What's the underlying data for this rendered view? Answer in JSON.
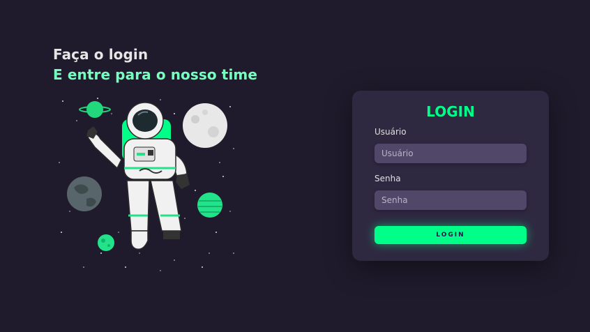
{
  "hero": {
    "title": "Faça o login",
    "subtitle": "E entre para o nosso time"
  },
  "illustration": {
    "name": "astronaut-illustration"
  },
  "login": {
    "title": "LOGIN",
    "username_label": "Usuário",
    "username_placeholder": "Usuário",
    "password_label": "Senha",
    "password_placeholder": "Senha",
    "button_label": "LOGIN"
  },
  "colors": {
    "background": "#201b2c",
    "card": "#2f2841",
    "input": "#514869",
    "accent": "#00ff88",
    "subtitle": "#77ffc0"
  }
}
